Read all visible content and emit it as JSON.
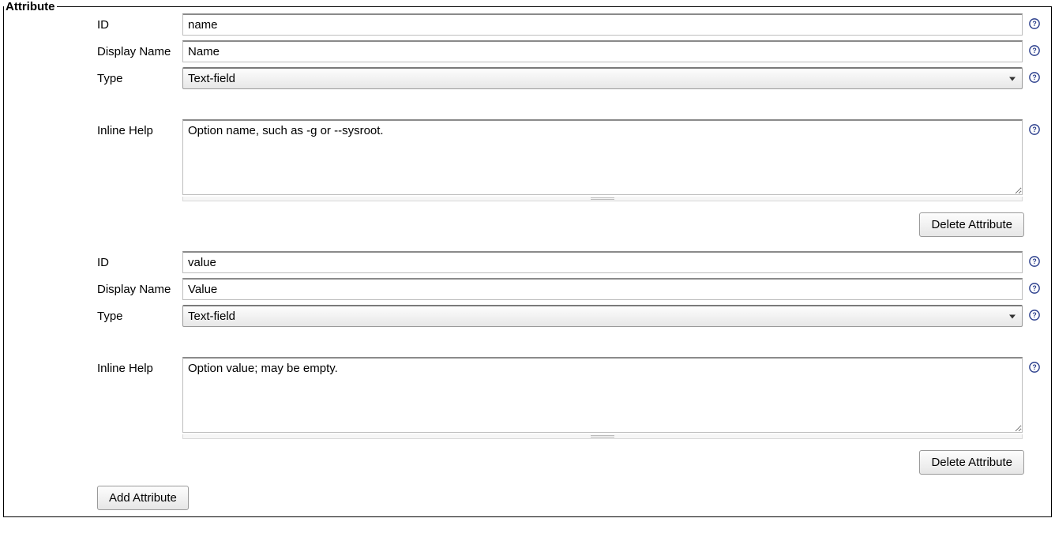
{
  "section_title": "Attribute",
  "labels": {
    "id": "ID",
    "display_name": "Display Name",
    "type": "Type",
    "inline_help": "Inline Help"
  },
  "buttons": {
    "delete_attribute": "Delete Attribute",
    "add_attribute": "Add Attribute"
  },
  "type_selected": "Text-field",
  "attributes": [
    {
      "id": "name",
      "display_name": "Name",
      "type": "Text-field",
      "inline_help": "Option name, such as -g or --sysroot."
    },
    {
      "id": "value",
      "display_name": "Value",
      "type": "Text-field",
      "inline_help": "Option value; may be empty."
    }
  ]
}
